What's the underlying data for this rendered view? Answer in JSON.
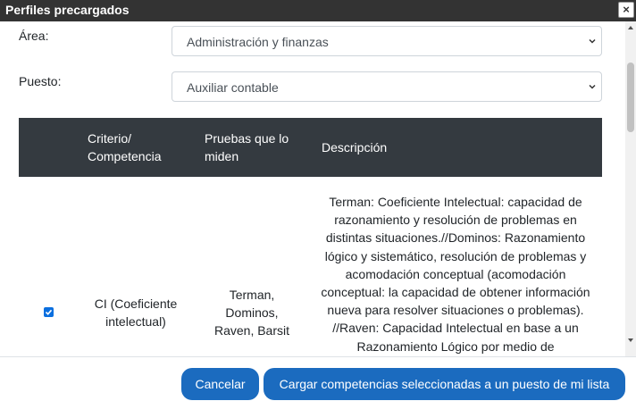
{
  "dialog": {
    "title": "Perfiles precargados",
    "close_glyph": "×"
  },
  "form": {
    "area": {
      "label": "Área:",
      "value": "Administración y finanzas"
    },
    "puesto": {
      "label": "Puesto:",
      "value": "Auxiliar contable"
    }
  },
  "table": {
    "headers": [
      "Criterio/\nCompetencia",
      "Pruebas que lo\nmiden",
      "Descripción"
    ],
    "rows": [
      {
        "checked": true,
        "criterio": "CI (Coeficiente intelectual)",
        "pruebas": "Terman, Dominos, Raven, Barsit",
        "descripcion": "Terman: Coeficiente Intelectual: capacidad de razonamiento y resolución de problemas en distintas situaciones.//Dominos: Razonamiento lógico y sistemático, resolución de problemas y acomodación conceptual (acomodación conceptual: la capacidad de obtener información nueva para resolver situaciones o problemas). //Raven: Capacidad Intelectual en base a un Razonamiento Lógico por medio de"
      }
    ]
  },
  "footer": {
    "cancel_label": "Cancelar",
    "load_label": "Cargar competencias seleccionadas a un puesto de mi lista"
  },
  "colors": {
    "titlebar": "#333333",
    "table_header": "#343a40",
    "primary_button": "#1b6bbf",
    "checkbox": "#0b6fdf"
  },
  "icons": [
    "close-icon",
    "chevron-down-icon",
    "check-icon",
    "scroll-up-arrow-icon",
    "scroll-down-arrow-icon"
  ]
}
